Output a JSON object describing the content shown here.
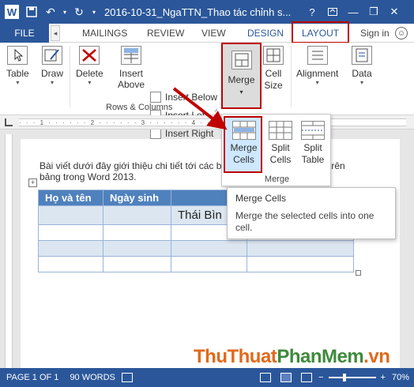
{
  "titlebar": {
    "title": "2016-10-31_NgaTTN_Thao tác chỉnh s...",
    "help": "?",
    "minimize": "—",
    "restore": "❐",
    "close": "✕"
  },
  "tabs": {
    "file": "FILE",
    "mailings": "MAILINGS",
    "review": "REVIEW",
    "view": "VIEW",
    "design": "DESIGN",
    "layout": "LAYOUT",
    "signin": "Sign in"
  },
  "ribbon": {
    "table": "Table",
    "draw": "Draw",
    "delete": "Delete",
    "insert_above": "Insert Above",
    "insert_below": "Insert Below",
    "insert_left": "Insert Left",
    "insert_right": "Insert Right",
    "rows_columns": "Rows & Columns",
    "merge": "Merge",
    "cell_size": "Cell Size",
    "alignment": "Alignment",
    "data": "Data"
  },
  "merge_menu": {
    "merge_cells": "Merge Cells",
    "split_cells": "Split Cells",
    "split_table": "Split Table",
    "group_label": "Merge"
  },
  "tooltip": {
    "title": "Merge Cells",
    "body": "Merge the selected cells into one cell."
  },
  "document": {
    "paragraph_line1": "Bài viết dưới đây giới thiệu chi tiết tới các b",
    "paragraph_tail": "trên",
    "paragraph_line2": "bảng trong Word 2013.",
    "table": {
      "headers": [
        "Họ và tên",
        "Ngày sinh",
        "",
        ""
      ],
      "merged_text": "Thái Bìn"
    }
  },
  "watermark": {
    "part1": "ThuThuat",
    "part2": "PhanMem",
    "part3": ".vn"
  },
  "statusbar": {
    "page": "PAGE 1 OF 1",
    "words": "90 WORDS",
    "zoom": "70%",
    "zoom_minus": "−",
    "zoom_plus": "+"
  },
  "colors": {
    "word_blue": "#2b579a",
    "table_header": "#4f81bd",
    "table_alt": "#dce6f1",
    "highlight_red": "#c00000"
  }
}
